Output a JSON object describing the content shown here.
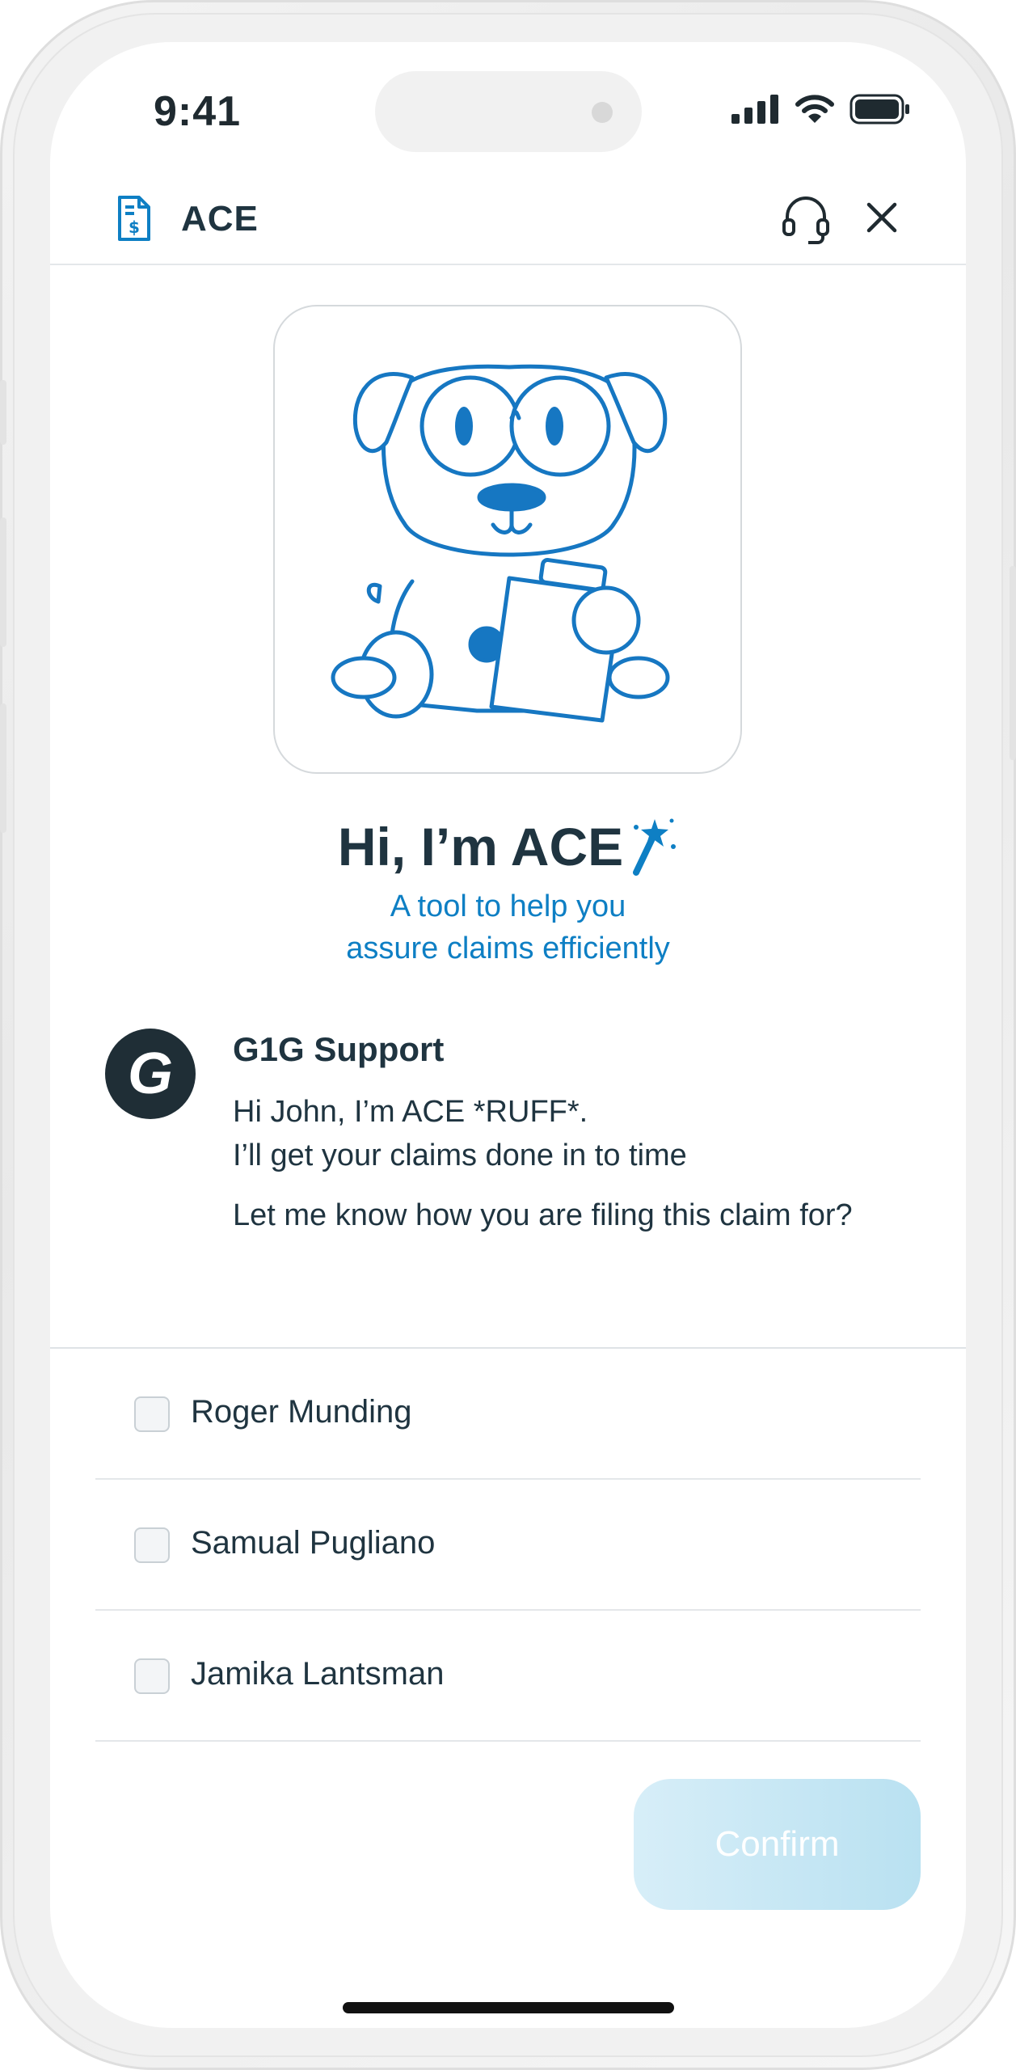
{
  "status": {
    "time": "9:41"
  },
  "header": {
    "title": "ACE",
    "left_icon": "invoice-document-icon",
    "support_icon": "headset-icon",
    "close_icon": "close-icon"
  },
  "hero": {
    "title": "Hi, I’m ACE",
    "subtitle_line1": "A tool to help you",
    "subtitle_line2": "assure claims efficiently",
    "mascot": "dog-with-clipboard-illustration"
  },
  "message": {
    "avatar_letter": "G",
    "sender": "G1G Support",
    "line1": "Hi John, I’m ACE *RUFF*.",
    "line2": "I’ll get your claims done in to time",
    "line3": "Let me know how you are filing this claim for?"
  },
  "options": [
    {
      "label": "Roger Munding",
      "checked": false
    },
    {
      "label": "Samual Pugliano",
      "checked": false
    },
    {
      "label": "Jamika Lantsman",
      "checked": false
    }
  ],
  "confirm_label": "Confirm",
  "colors": {
    "accent": "#0e7fc4",
    "text_dark": "#1f3440",
    "button_disabled": "#c7e7f5"
  }
}
